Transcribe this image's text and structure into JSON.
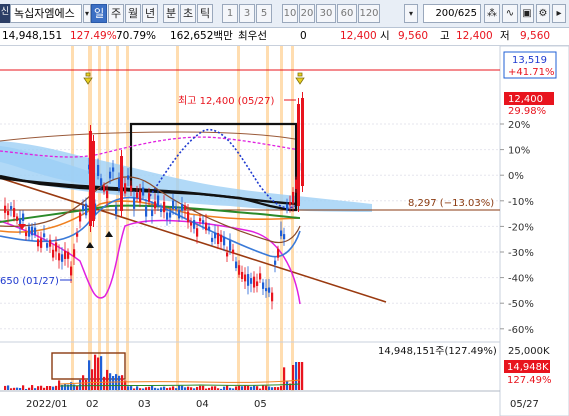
{
  "toolbar": {
    "name_icon": "신",
    "stock_name": "녹십자엠에스",
    "periods": [
      "일",
      "주",
      "월",
      "년",
      "분",
      "초",
      "틱"
    ],
    "selected_period": "일",
    "minutes": [
      "1",
      "3",
      "5",
      "10",
      "20",
      "30",
      "60",
      "120"
    ],
    "count_value": "200",
    "count_total": "/625"
  },
  "infobar": {
    "volume": "14,948,151",
    "volume_ratio": "127.49%",
    "turnover_pct": "70.79%",
    "amount": "162,652백만",
    "priority_label": "최우선",
    "priority_value": "0",
    "current_price": "12,400",
    "open_label": "시",
    "open_value": "9,560",
    "high_label": "고",
    "high_value": "12,400",
    "low_label": "저",
    "low_value": "9,560"
  },
  "chart_data": {
    "type": "candlestick",
    "y_axis": {
      "unit": "%",
      "ticks": [
        "20%",
        "10%",
        "0%",
        "-10%",
        "-20%",
        "-30%",
        "-40%",
        "-50%",
        "-60%"
      ]
    },
    "price_labels": {
      "top_current": "13,519",
      "top_change": "+41.71%",
      "last_price": "12,400",
      "last_change": "29.98%",
      "high_annotation": "최고 12,400 (05/27)",
      "low_annotation": "650 (01/27)",
      "ref_line": "8,297 (−13.03%)"
    },
    "volume": {
      "label": "14,948,151주(127.49%)",
      "axis_top": "25,000K",
      "last_value": "14,948K",
      "last_ratio": "127.49%"
    },
    "x_axis": {
      "labels": [
        "2022/01",
        "02",
        "03",
        "04",
        "05"
      ],
      "right_label": "05/27"
    },
    "colors": {
      "up": "#e8141e",
      "down": "#1f5fd6",
      "highlight_band": "#ffcf90",
      "cloud": "#9ecff5"
    }
  }
}
